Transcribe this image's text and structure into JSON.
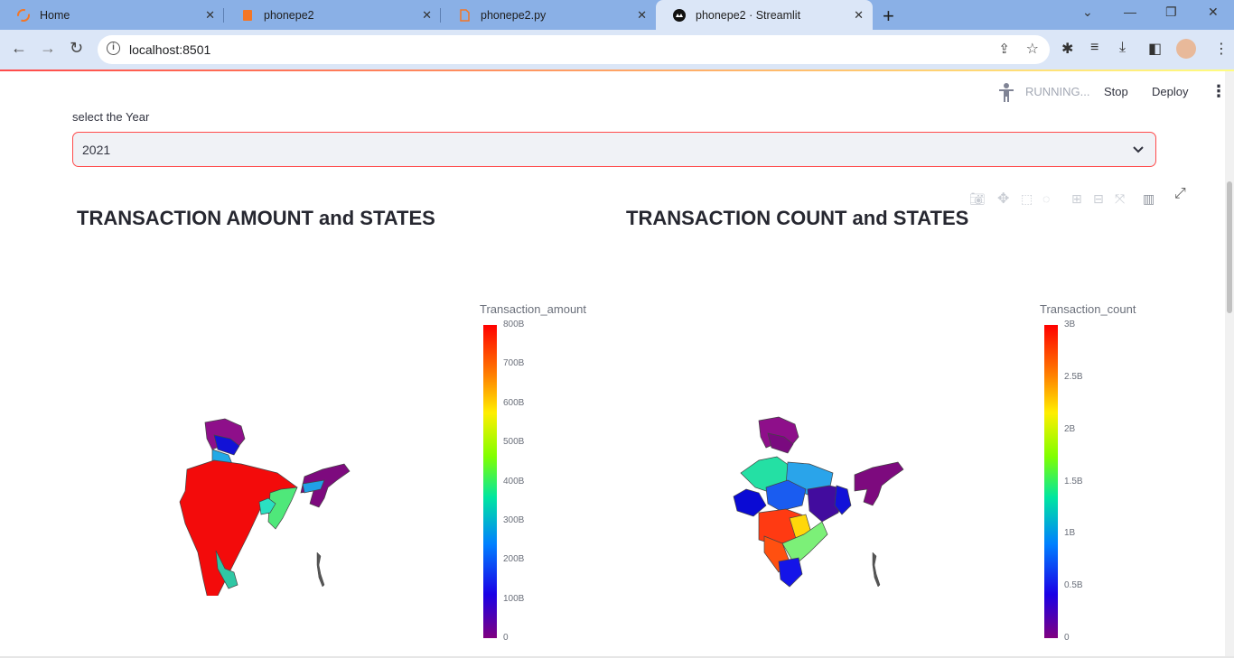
{
  "browser": {
    "tabs": [
      {
        "label": "Home",
        "icon": "loader-icon"
      },
      {
        "label": "phonepe2",
        "icon": "notebook-icon"
      },
      {
        "label": "phonepe2.py",
        "icon": "file-icon"
      },
      {
        "label": "phonepe2 · Streamlit",
        "icon": "streamlit-icon"
      }
    ],
    "url": "localhost:8501"
  },
  "header": {
    "status": "RUNNING...",
    "stop": "Stop",
    "deploy": "Deploy"
  },
  "select": {
    "label": "select the Year",
    "value": "2021"
  },
  "charts": {
    "amount": {
      "title": "TRANSACTION AMOUNT and STATES",
      "colorbar_title": "Transaction_amount",
      "ticks": [
        "800B",
        "700B",
        "600B",
        "500B",
        "400B",
        "300B",
        "200B",
        "100B",
        "0"
      ]
    },
    "count": {
      "title": "TRANSACTION COUNT and STATES",
      "colorbar_title": "Transaction_count",
      "ticks": [
        "3B",
        "2.5B",
        "2B",
        "1.5B",
        "1B",
        "0.5B",
        "0"
      ]
    }
  },
  "chart_data": [
    {
      "type": "choropleth",
      "title": "TRANSACTION AMOUNT and STATES",
      "colorbar": {
        "title": "Transaction_amount",
        "range": [
          0,
          800
        ],
        "unit": "B",
        "ticks": [
          "0",
          "100B",
          "200B",
          "300B",
          "400B",
          "500B",
          "600B",
          "700B",
          "800B"
        ]
      },
      "colorscale": "rainbow"
    },
    {
      "type": "choropleth",
      "title": "TRANSACTION COUNT and STATES",
      "colorbar": {
        "title": "Transaction_count",
        "range": [
          0,
          3
        ],
        "unit": "B",
        "ticks": [
          "0",
          "0.5B",
          "1B",
          "1.5B",
          "2B",
          "2.5B",
          "3B"
        ]
      },
      "colorscale": "rainbow"
    }
  ]
}
